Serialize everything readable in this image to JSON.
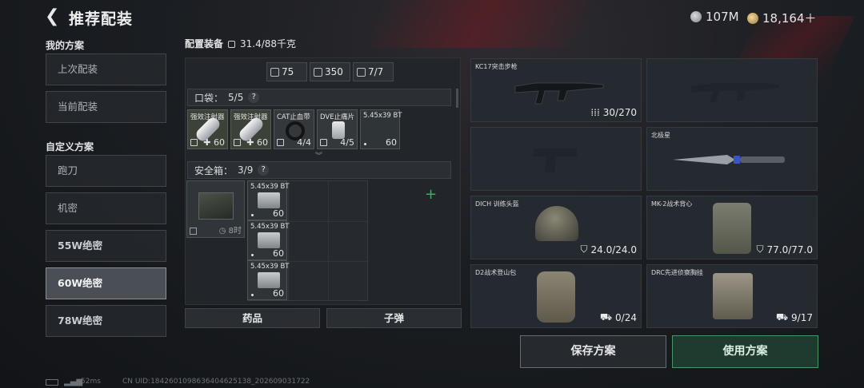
{
  "header": {
    "title": "推荐配装",
    "currency1": "107M",
    "currency2": "18,164＋",
    "plus_label": "＋"
  },
  "sidebar": {
    "section_mine": "我的方案",
    "mine": [
      "上次配装",
      "当前配装"
    ],
    "section_custom": "自定义方案",
    "custom": [
      "跑刀",
      "机密",
      "55W绝密",
      "60W绝密",
      "78W绝密"
    ],
    "active": "60W绝密"
  },
  "loadout": {
    "label": "配置装备",
    "weight": "31.4/88千克",
    "stats": [
      "75",
      "350",
      "7/7"
    ],
    "pocket": {
      "label": "口袋：",
      "count": "5/5",
      "q": "?"
    },
    "pocket_items": [
      {
        "name": "强效注射器",
        "count": "60"
      },
      {
        "name": "强效注射器",
        "count": "60"
      },
      {
        "name": "CAT止血带",
        "count": "4/4"
      },
      {
        "name": "DVE止痛片",
        "count": "4/5"
      },
      {
        "name": "5.45x39 BT",
        "count": "60"
      }
    ],
    "safebox": {
      "label": "安全箱：",
      "count": "3/9",
      "q": "?",
      "timer": "8时"
    },
    "safebox_items": [
      {
        "name": "5.45x39 BT",
        "count": "60"
      },
      {
        "name": "5.45x39 BT",
        "count": "60"
      },
      {
        "name": "5.45x39 BT",
        "count": "60"
      }
    ],
    "tabs": [
      "药品",
      "子弹"
    ]
  },
  "slots": {
    "primary": {
      "name": "KC17突击步枪",
      "value": "30/270"
    },
    "secondary": {
      "name": "",
      "value": ""
    },
    "pistol": {
      "name": "",
      "value": ""
    },
    "melee": {
      "name": "北极星",
      "value": ""
    },
    "helmet": {
      "name": "DICH 训练头盔",
      "value": "24.0/24.0"
    },
    "armor": {
      "name": "MK-2战术背心",
      "value": "77.0/77.0"
    },
    "backpack": {
      "name": "D2战术登山包",
      "value": "0/24"
    },
    "rig": {
      "name": "DRC先进侦察胸挂",
      "value": "9/17"
    }
  },
  "buttons": {
    "save": "保存方案",
    "use": "使用方案"
  },
  "footer": {
    "ping": "52ms",
    "uid": "CN UID:18426010986364046251​38_202609031722"
  },
  "colors": {
    "accent_green": "#3f9a63",
    "active_plan": "#4a4f55"
  }
}
